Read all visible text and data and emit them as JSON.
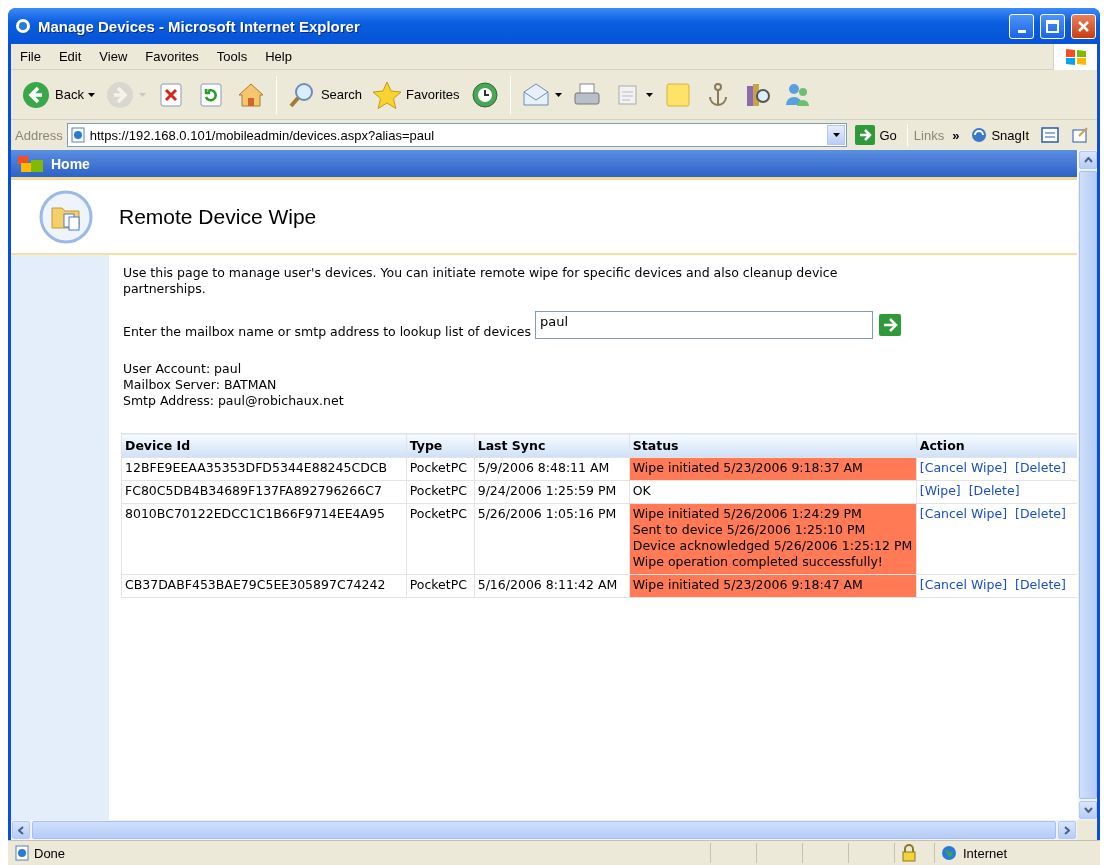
{
  "window": {
    "title": "Manage Devices - Microsoft Internet Explorer"
  },
  "menu": [
    "File",
    "Edit",
    "View",
    "Favorites",
    "Tools",
    "Help"
  ],
  "toolbar": [
    [
      {
        "kind": "back",
        "label": "Back",
        "dropdown": true,
        "disabled": false
      },
      {
        "kind": "forward",
        "dropdown": true,
        "disabled": true
      },
      {
        "kind": "stop",
        "dropdown": false,
        "disabled": false
      },
      {
        "kind": "refresh",
        "dropdown": false,
        "disabled": false
      },
      {
        "kind": "home",
        "dropdown": false,
        "disabled": false
      }
    ],
    [
      {
        "kind": "search",
        "label": "Search",
        "dropdown": false,
        "disabled": false
      },
      {
        "kind": "favorites",
        "label": "Favorites",
        "dropdown": false,
        "disabled": false
      },
      {
        "kind": "history",
        "dropdown": false,
        "disabled": false
      }
    ],
    [
      {
        "kind": "mail",
        "dropdown": true,
        "disabled": false
      },
      {
        "kind": "print",
        "dropdown": false,
        "disabled": false
      },
      {
        "kind": "edit",
        "dropdown": true,
        "disabled": false
      },
      {
        "kind": "note",
        "dropdown": false,
        "disabled": false
      },
      {
        "kind": "anchor",
        "dropdown": false,
        "disabled": false
      },
      {
        "kind": "research",
        "dropdown": false,
        "disabled": false
      },
      {
        "kind": "messenger",
        "dropdown": false,
        "disabled": false
      }
    ]
  ],
  "address": {
    "label": "Address",
    "value": "https://192.168.0.101/mobileadmin/devices.aspx?alias=paul",
    "go": "Go"
  },
  "links": {
    "label": "Links",
    "chevron": "»",
    "items": [
      {
        "kind": "snagit",
        "label": "SnagIt"
      },
      {
        "kind": "capture"
      },
      {
        "kind": "edit"
      }
    ]
  },
  "page": {
    "nav": "Home",
    "title": "Remote Device Wipe",
    "intro": "Use this page to manage user's devices. You can initiate remote wipe for specific devices and also cleanup device partnerships.",
    "lookup": {
      "label": "Enter the mailbox name or smtp address to lookup list of devices",
      "value": "paul"
    },
    "account": [
      "User Account: paul",
      "Mailbox Server: BATMAN",
      "Smtp Address: paul@robichaux.net"
    ]
  },
  "table": {
    "columns": [
      "Device Id",
      "Type",
      "Last Sync",
      "Status",
      "Action"
    ],
    "rows": [
      {
        "device_id": "12BFE9EEAA35353DFD5344E88245CDCB",
        "type": "PocketPC",
        "last_sync": "5/9/2006 8:48:11 AM",
        "status": [
          "Wipe initiated 5/23/2006 9:18:37 AM"
        ],
        "highlighted": true,
        "actions": [
          "[Cancel Wipe]",
          "[Delete]"
        ]
      },
      {
        "device_id": "FC80C5DB4B34689F137FA892796266C7",
        "type": "PocketPC",
        "last_sync": "9/24/2006 1:25:59 PM",
        "status": [
          "OK"
        ],
        "highlighted": false,
        "actions": [
          "[Wipe]",
          "[Delete]"
        ]
      },
      {
        "device_id": "8010BC70122EDCC1C1B66F9714EE4A95",
        "type": "PocketPC",
        "last_sync": "5/26/2006 1:05:16 PM",
        "status": [
          "Wipe initiated 5/26/2006 1:24:29 PM",
          "Sent to device 5/26/2006 1:25:10 PM",
          "Device acknowledged 5/26/2006 1:25:12 PM",
          "Wipe operation completed successfully!"
        ],
        "highlighted": true,
        "actions": [
          "[Cancel Wipe]",
          "[Delete]"
        ]
      },
      {
        "device_id": "CB37DABF453BAE79C5EE305897C74242",
        "type": "PocketPC",
        "last_sync": "5/16/2006 8:11:42 AM",
        "status": [
          "Wipe initiated 5/23/2006 9:18:47 AM"
        ],
        "highlighted": true,
        "actions": [
          "[Cancel Wipe]",
          "[Delete]"
        ]
      }
    ]
  },
  "status_bar": {
    "text": "Done",
    "zone": "Internet",
    "secure": true
  }
}
